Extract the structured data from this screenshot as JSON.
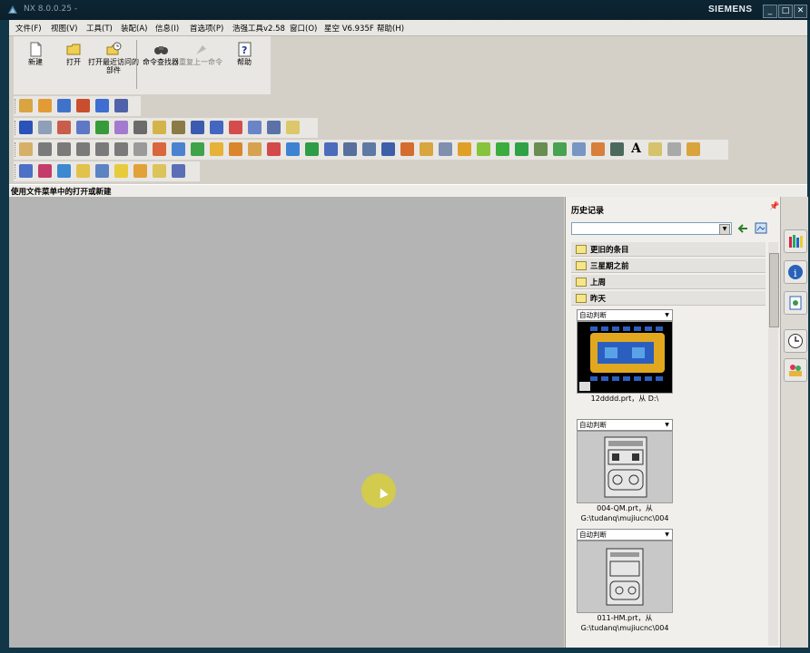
{
  "window": {
    "title": "NX 8.0.0.25 -",
    "brand": "SIEMENS",
    "controls": [
      "_",
      "□",
      "✕"
    ]
  },
  "menubar": {
    "items": [
      "文件(F)",
      "视图(V)",
      "工具(T)",
      "装配(A)",
      "信息(I)",
      "首选项(P)",
      "浩强工具v2.58",
      "窗口(O)",
      "星空 V6.935F",
      "帮助(H)"
    ]
  },
  "standard_toolbar": {
    "new_label": "新建",
    "open_label": "打开",
    "open_recent_label": "打开最近访问的部件",
    "command_finder_label": "命令查找器",
    "repeat_label": "重复上一命令",
    "help_label": "帮助"
  },
  "status_bar": {
    "text": "使用文件菜单中的打开或新建"
  },
  "history_panel": {
    "title": "历史记录",
    "groups": [
      "更旧的条目",
      "三星期之前",
      "上周",
      "昨天"
    ],
    "items": [
      {
        "mode": "自动判断",
        "caption_line1": "12dddd.prt，从 D:\\",
        "caption_line2": ""
      },
      {
        "mode": "自动判断",
        "caption_line1": "004-QM.prt，从",
        "caption_line2": "G:\\tudanq\\mujiucnc\\004"
      },
      {
        "mode": "自动判断",
        "caption_line1": "011-HM.prt，从",
        "caption_line2": "G:\\tudanq\\mujiucnc\\004"
      }
    ]
  },
  "accent_colors": {
    "titlebar": "#0b1f2c",
    "graphics_bg": "#b4b4b4",
    "cursor_highlight": "#d8cf3b"
  },
  "right_tabs": [
    "parts-navigator-icon",
    "info-icon",
    "roles-icon",
    "history-clock-icon",
    "resource-icon"
  ]
}
